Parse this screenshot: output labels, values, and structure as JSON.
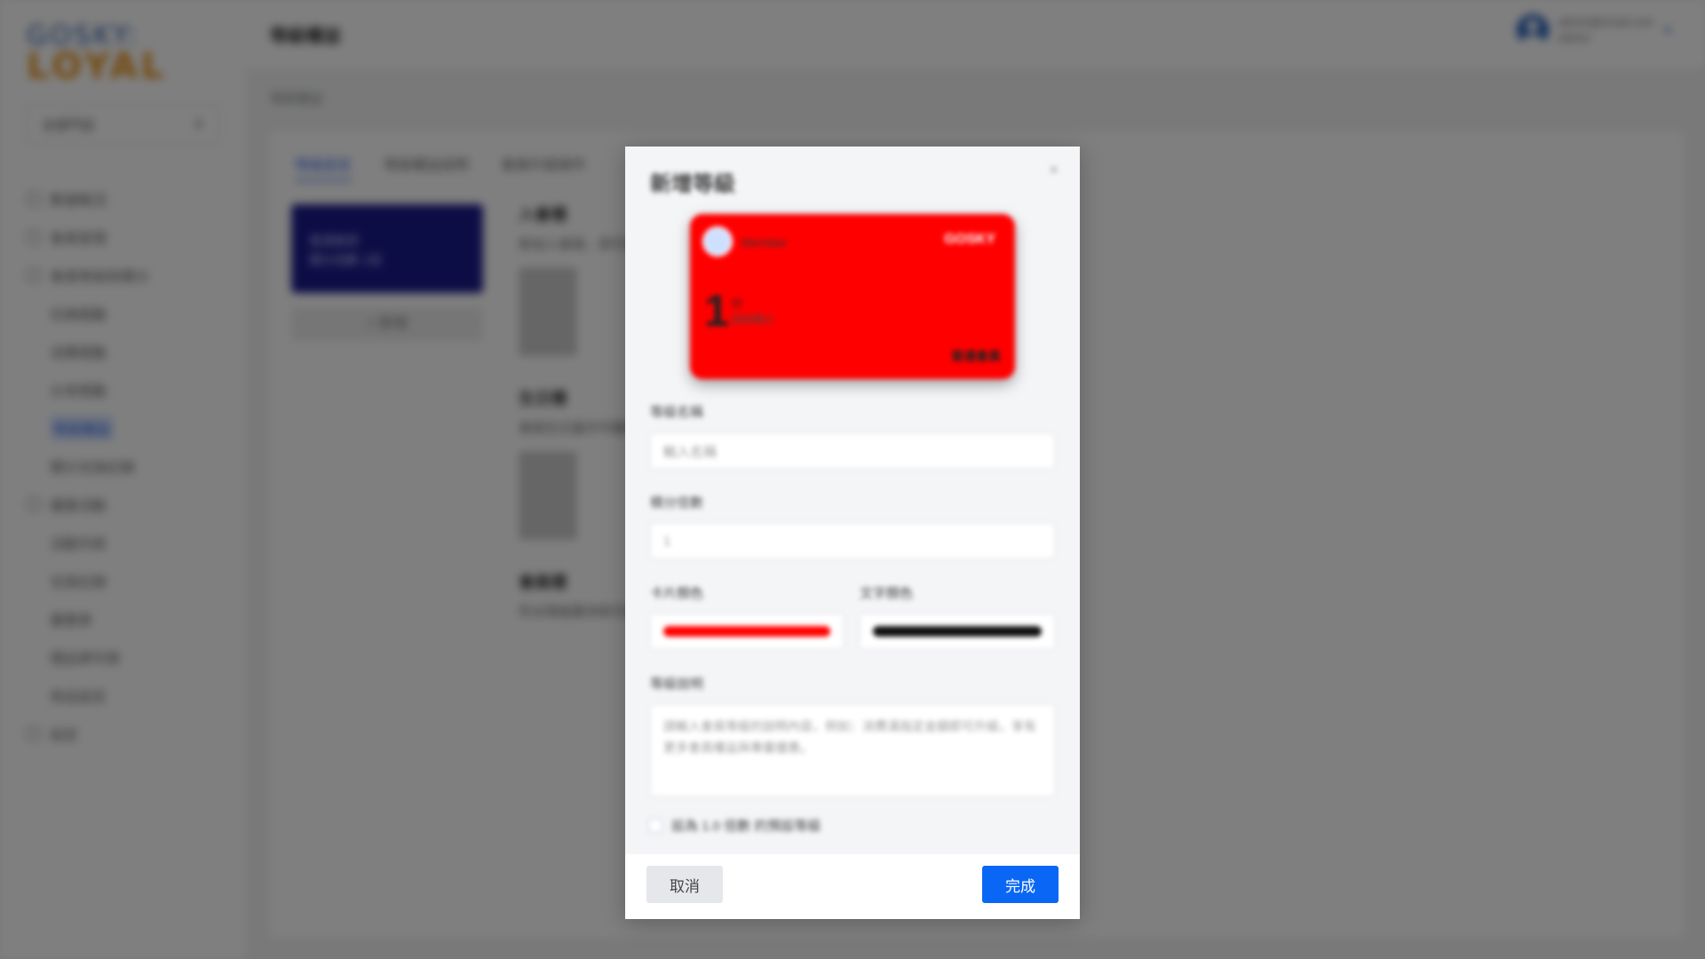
{
  "app": {
    "logo_top": "GOSKY:",
    "logo_bottom": "LOYAL",
    "store_select": "全部門店",
    "sidebar_items": [
      {
        "label": "數據概況"
      },
      {
        "label": "會員管理"
      },
      {
        "label": "會員等級與積分"
      },
      {
        "label": "任務獎勵"
      },
      {
        "label": "消費獎勵"
      },
      {
        "label": "分享獎勵"
      },
      {
        "label": "等級權益"
      },
      {
        "label": "積分兌換記錄"
      },
      {
        "label": "優惠活動"
      },
      {
        "label": "活動列表"
      },
      {
        "label": "兌換記錄"
      },
      {
        "label": "優惠券"
      },
      {
        "label": "禮品券列表"
      },
      {
        "label": "商品設定"
      },
      {
        "label": "設定"
      }
    ],
    "page_title": "等級權益",
    "user_email": "admin@email.com",
    "user_role": "Admin",
    "breadcrumb": "等級權益",
    "tabs": [
      "等級設定",
      "等級權益說明",
      "會員升級條件"
    ],
    "tier_card_title": "普通會員",
    "tier_card_sub": "積分倍數 1倍",
    "tier_add": "+ 新增",
    "tiers": [
      {
        "name": "入會禮",
        "desc": "新加入會員，即可獲得"
      },
      {
        "name": "生日禮",
        "desc": "會員生日當月可獲得"
      },
      {
        "name": "會員禮",
        "desc": "符合等級要求即可獲得"
      }
    ]
  },
  "modal": {
    "title": "新增等級",
    "close": "×",
    "preview": {
      "member_name": "Member",
      "brand": "GOSKY",
      "points": "1",
      "points_unit": "分",
      "points_sub": "目前積分",
      "tier_label": "普通會員"
    },
    "tier_name_label": "等級名稱",
    "tier_name_placeholder": "輸入名稱",
    "points_multiplier_label": "積分倍數",
    "points_multiplier_value": "1",
    "card_color_label": "卡片顏色",
    "card_color": "#ff0000",
    "text_color_label": "文字顏色",
    "text_color": "#111111",
    "description_label": "等級說明",
    "description_placeholder": "請輸入會員等級的說明內容，例如：消費滿指定金額即可升級，享有更多會員權益與專屬優惠。",
    "default_checkbox_label": "設為 1.0 倍數 的預設等級",
    "cancel_label": "取消",
    "done_label": "完成"
  },
  "colors": {
    "primary_button": "#0a67f5",
    "card_red": "#ff0000",
    "sidebar_active": "#2d63e6"
  }
}
